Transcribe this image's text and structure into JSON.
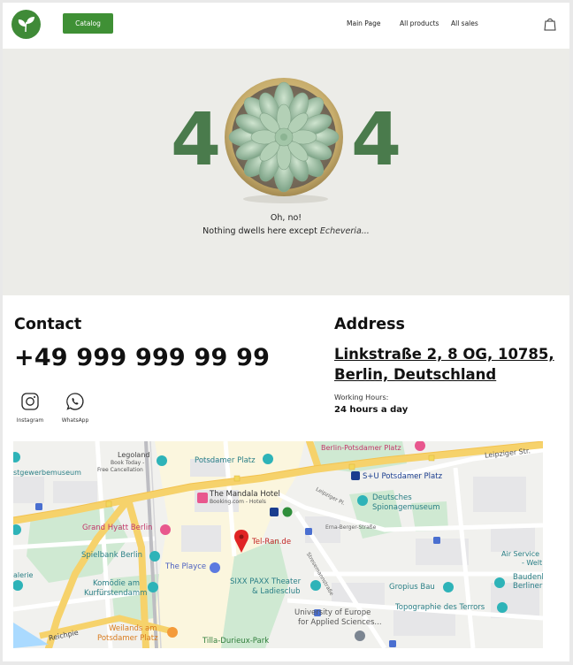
{
  "header": {
    "catalog_label": "Catalog",
    "nav": [
      "Main Page",
      "All products",
      "All sales"
    ],
    "accent_color": "#3f9035"
  },
  "hero": {
    "digit_left": "4",
    "digit_right": "4",
    "line1": "Oh, no!",
    "line2_prefix": "Nothing dwells here except",
    "line2_em": "Echeveria...",
    "digit_color": "#4a7b4c"
  },
  "contact": {
    "title": "Contact",
    "phone": "+49 999 999 99 99",
    "socials": [
      {
        "label": "Instagram",
        "icon": "instagram-icon"
      },
      {
        "label": "WhatsApp",
        "icon": "whatsapp-icon"
      }
    ]
  },
  "address": {
    "title": "Address",
    "line1": "Linkstraße 2, 8 OG, 10785,",
    "line2": "Berlin, Deutschland",
    "hours_label": "Working Hours:",
    "hours_value": "24 hours a day"
  },
  "map": {
    "labels": {
      "legoland": "Legoland",
      "legoland_sub1": "Book Today -",
      "legoland_sub2": "Free Cancellation",
      "kunst": "stgewerbemuseum",
      "potsdamer": "Potsdamer Platz",
      "berlin_pp": "Berlin-Potsdamer Platz",
      "leipziger": "Leipziger Str.",
      "su_pp": "S+U Potsdamer Platz",
      "mandala": "The Mandala Hotel",
      "mandala_sub": "Booking.com - Hotels",
      "leipziger_pl": "Leipziger Pl.",
      "spionage1": "Deutsches",
      "spionage2": "Spionagemuseum",
      "hyatt": "Grand Hyatt Berlin",
      "telran": "Tel-Ran.de",
      "erna": "Erna-Berger-Straße",
      "spielbank": "Spielbank Berlin",
      "playce": "The Playce",
      "stresemann": "Stresemannstraße",
      "air1": "Air Service",
      "air2": "- Welt",
      "alerie": "alerie",
      "komodie1": "Komödie am",
      "komodie2": "Kurfürstendamm",
      "sixx1": "SIXX PAXX Theater",
      "sixx2": "& Ladiesclub",
      "gropius": "Gropius Bau",
      "baudenk1": "Baudenkm",
      "baudenk2": "Berliner M",
      "topo": "Topographie des Terrors",
      "uni1": "University of Europe",
      "uni2": "for Applied Sciences...",
      "reichpie": "Reichpie",
      "weilands1": "Weilands am",
      "weilands2": "Potsdamer Platz",
      "tilla": "Tilla-Durieux-Park"
    }
  }
}
